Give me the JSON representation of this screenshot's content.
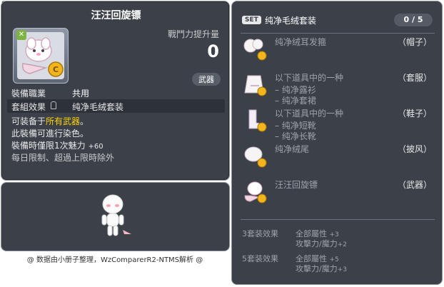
{
  "item_id": "01703588",
  "item": {
    "name": "汪汪回旋镖",
    "power_label": "戰鬥力提升量",
    "power_value": "0",
    "category_tag": "武器",
    "job_label": "裝備職業",
    "job_value": "共用",
    "set_label": "套組效果",
    "set_value": "纯净毛绒套装",
    "desc_line1_prefix": "可装备于",
    "desc_line1_highlight": "所有武器",
    "desc_line1_suffix": "。",
    "desc_line2": "此裝備可進行染色。",
    "desc_line3_prefix": "裝備時僅限1次魅力",
    "desc_line3_value": "+60",
    "desc_line4": "每日限制、超過上限時除外"
  },
  "credit": "@ 数据由小册子整理，WzComparerR2-NTMS解析 @",
  "set_panel": {
    "badge": "SET",
    "name": "纯净毛绒套装",
    "count": "0 / 5",
    "pieces": [
      {
        "name": "纯净绒耳发箍",
        "subs": [],
        "slot": "（帽子）"
      },
      {
        "name": "以下道具中的一种",
        "subs": [
          "– 纯净露衫",
          "– 纯净套裙"
        ],
        "slot": "（套服）"
      },
      {
        "name": "以下道具中的一种",
        "subs": [
          "– 纯净短靴",
          "– 纯净长靴"
        ],
        "slot": "（鞋子）"
      },
      {
        "name": "纯净绒尾",
        "subs": [],
        "slot": "（披风）"
      },
      {
        "name": "汪汪回旋镖",
        "subs": [],
        "slot": "（武器）"
      }
    ],
    "bonuses": [
      {
        "label": "3套装效果",
        "stat1": "全部屬性",
        "val1": "+3",
        "stat2": "攻擊力/魔力",
        "val2": "+2"
      },
      {
        "label": "5套装效果",
        "stat1": "全部屬性",
        "val1": "+5",
        "stat2": "攻擊力/魔力",
        "val2": "+3"
      }
    ]
  },
  "colors": {
    "panel_bg": "#3b4049",
    "highlight_yellow": "#ffd400",
    "muted_text": "#9ea3aa"
  }
}
